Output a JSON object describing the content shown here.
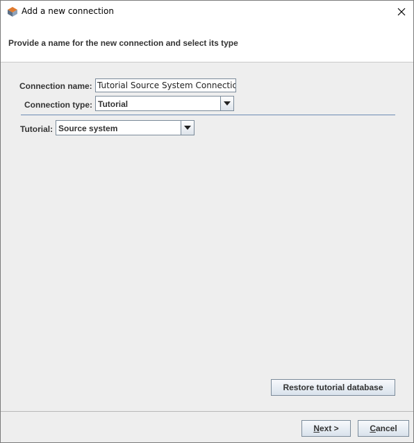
{
  "window": {
    "title": "Add a new connection"
  },
  "header": {
    "text": "Provide a name for the new connection and select its type"
  },
  "form": {
    "connection_name_label": "Connection name:",
    "connection_name_value": "Tutorial Source System Connection",
    "connection_type_label": "Connection type:",
    "connection_type_value": "Tutorial",
    "tutorial_label": "Tutorial:",
    "tutorial_value": "Source system"
  },
  "buttons": {
    "restore": "Restore tutorial database",
    "next_mnemonic": "N",
    "next_rest": "ext >",
    "cancel_mnemonic": "C",
    "cancel_rest": "ancel"
  },
  "icons": {
    "app": "connection-app-icon",
    "close": "close-icon",
    "dropdown": "chevron-down-icon"
  }
}
